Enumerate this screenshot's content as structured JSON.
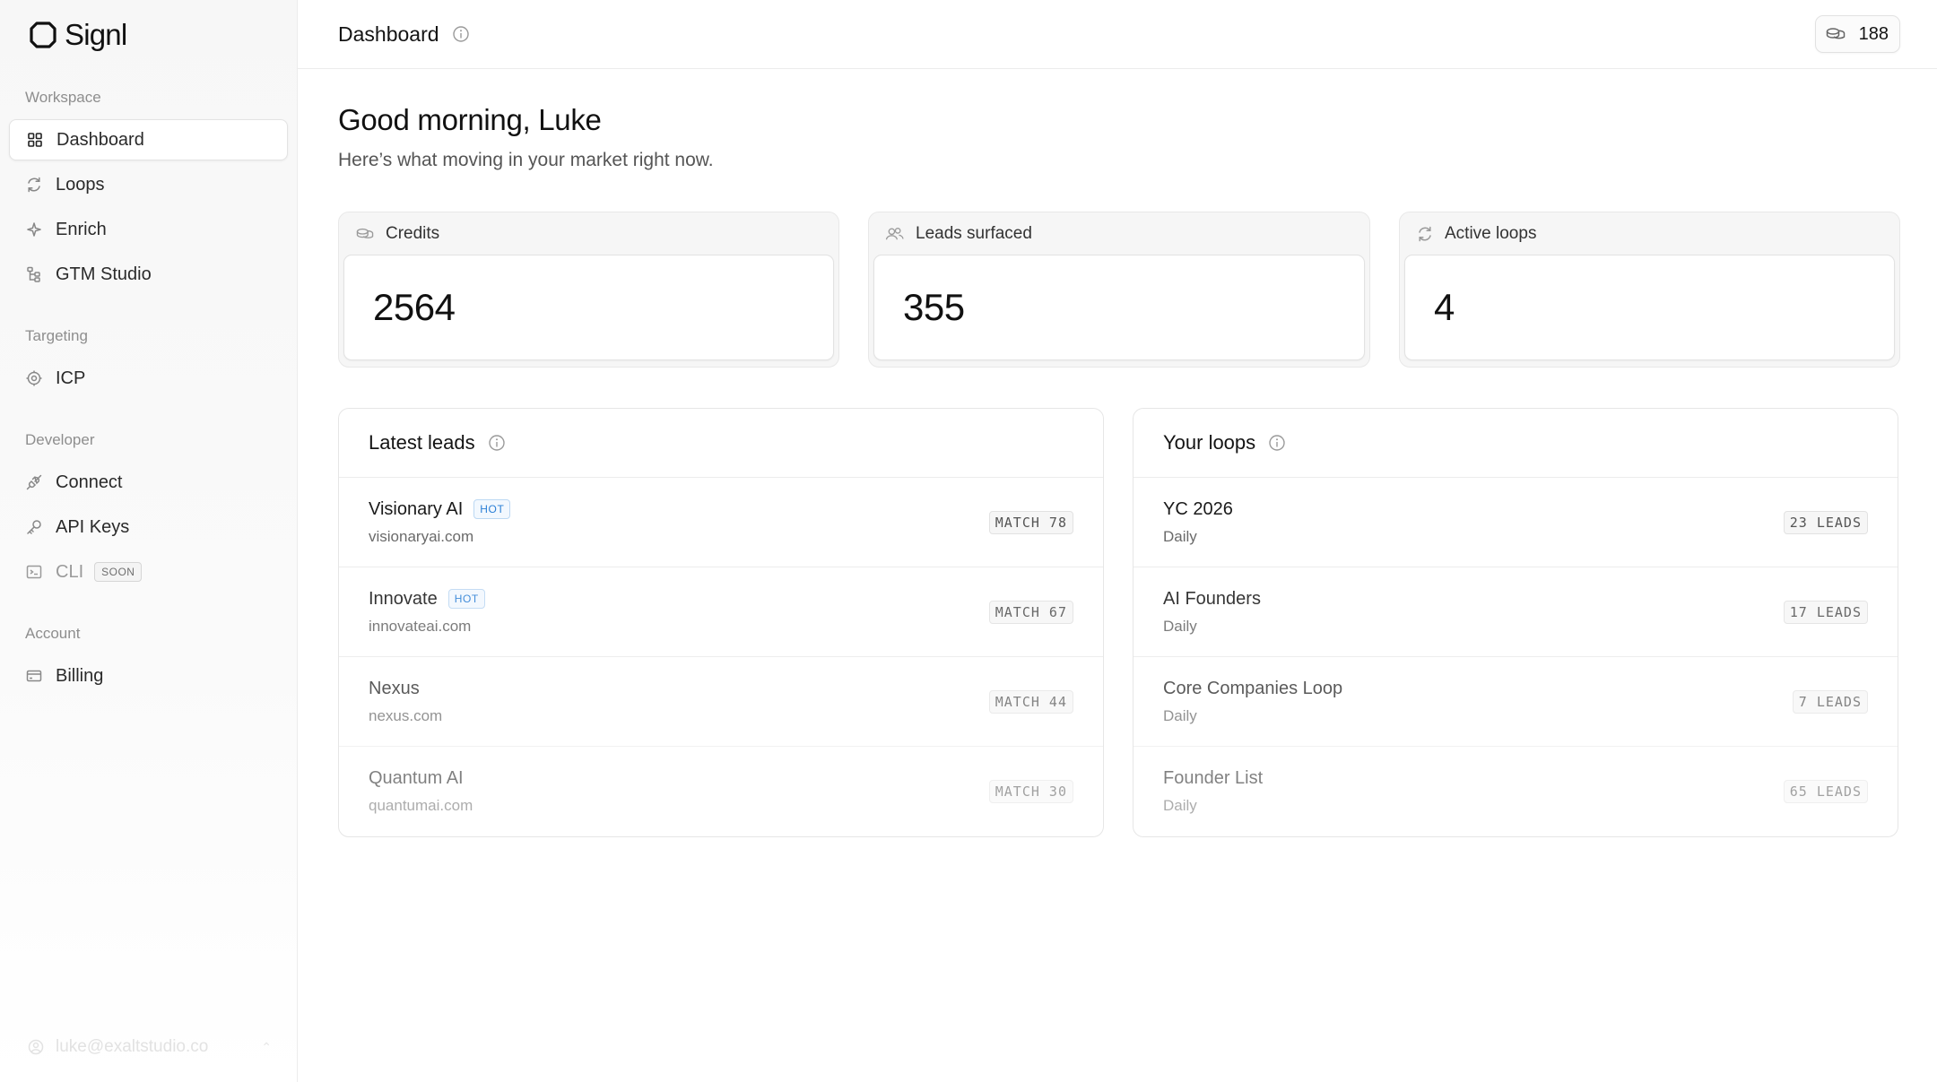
{
  "brand": {
    "name": "Signl"
  },
  "sidebar": {
    "sections": [
      {
        "title": "Workspace",
        "items": [
          {
            "label": "Dashboard",
            "icon": "grid-icon",
            "active": true
          },
          {
            "label": "Loops",
            "icon": "refresh-icon"
          },
          {
            "label": "Enrich",
            "icon": "sparkle-icon"
          },
          {
            "label": "GTM Studio",
            "icon": "tree-icon"
          }
        ]
      },
      {
        "title": "Targeting",
        "items": [
          {
            "label": "ICP",
            "icon": "target-icon"
          }
        ]
      },
      {
        "title": "Developer",
        "items": [
          {
            "label": "Connect",
            "icon": "plug-icon"
          },
          {
            "label": "API Keys",
            "icon": "key-icon"
          },
          {
            "label": "CLI",
            "icon": "terminal-icon",
            "badge": "SOON"
          }
        ]
      },
      {
        "title": "Account",
        "items": [
          {
            "label": "Billing",
            "icon": "card-icon"
          }
        ]
      }
    ],
    "footer": {
      "email": "luke@exaltstudio.co"
    }
  },
  "topbar": {
    "title": "Dashboard",
    "credits": "188"
  },
  "greeting": {
    "title": "Good morning, Luke",
    "subtitle": "Here’s what moving in your market right now."
  },
  "stats": [
    {
      "label": "Credits",
      "value": "2564",
      "icon": "coins-icon"
    },
    {
      "label": "Leads surfaced",
      "value": "355",
      "icon": "users-icon"
    },
    {
      "label": "Active loops",
      "value": "4",
      "icon": "refresh-icon"
    }
  ],
  "latest_leads": {
    "title": "Latest leads",
    "rows": [
      {
        "name": "Visionary AI",
        "domain": "visionaryai.com",
        "badge": "HOT",
        "match": "MATCH 78"
      },
      {
        "name": "Innovate",
        "domain": "innovateai.com",
        "badge": "HOT",
        "match": "MATCH 67"
      },
      {
        "name": "Nexus",
        "domain": "nexus.com",
        "match": "MATCH 44"
      },
      {
        "name": "Quantum AI",
        "domain": "quantumai.com",
        "match": "MATCH 30"
      }
    ]
  },
  "your_loops": {
    "title": "Your loops",
    "rows": [
      {
        "name": "YC 2026",
        "frequency": "Daily",
        "leads": "23 LEADS"
      },
      {
        "name": "AI Founders",
        "frequency": "Daily",
        "leads": "17 LEADS"
      },
      {
        "name": "Core Companies Loop",
        "frequency": "Daily",
        "leads": "7 LEADS"
      },
      {
        "name": "Founder List",
        "frequency": "Daily",
        "leads": "65 LEADS"
      }
    ]
  }
}
